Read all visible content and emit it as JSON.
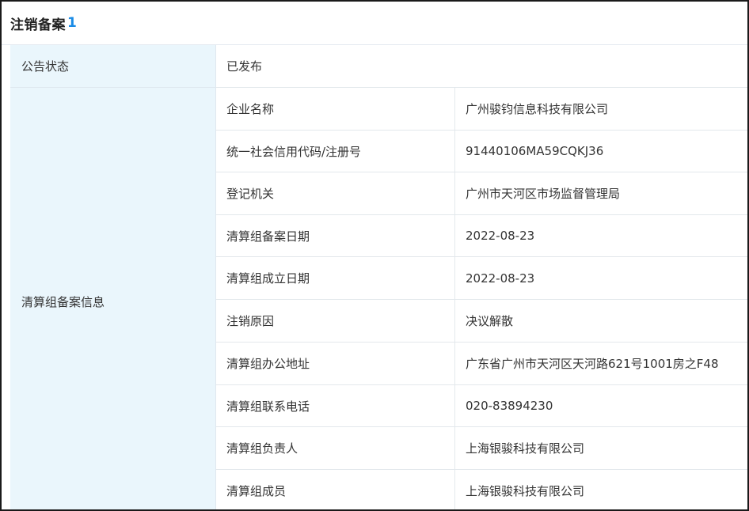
{
  "section": {
    "title": "注销备案",
    "count": "1"
  },
  "status": {
    "label": "公告状态",
    "value": "已发布"
  },
  "liquidation": {
    "group_label": "清算组备案信息",
    "rows": [
      {
        "field": "企业名称",
        "value": "广州骏钧信息科技有限公司"
      },
      {
        "field": "统一社会信用代码/注册号",
        "value": "91440106MA59CQKJ36"
      },
      {
        "field": "登记机关",
        "value": "广州市天河区市场监督管理局"
      },
      {
        "field": "清算组备案日期",
        "value": "2022-08-23"
      },
      {
        "field": "清算组成立日期",
        "value": "2022-08-23"
      },
      {
        "field": "注销原因",
        "value": "决议解散"
      },
      {
        "field": "清算组办公地址",
        "value": "广东省广州市天河区天河路621号1001房之F48"
      },
      {
        "field": "清算组联系电话",
        "value": "020-83894230"
      },
      {
        "field": "清算组负责人",
        "value": "上海银骏科技有限公司"
      },
      {
        "field": "清算组成员",
        "value": "上海银骏科技有限公司"
      }
    ]
  },
  "colors": {
    "label_background": "#eaf6fc",
    "accent": "#1a8be6",
    "border": "#e3e8ec"
  }
}
